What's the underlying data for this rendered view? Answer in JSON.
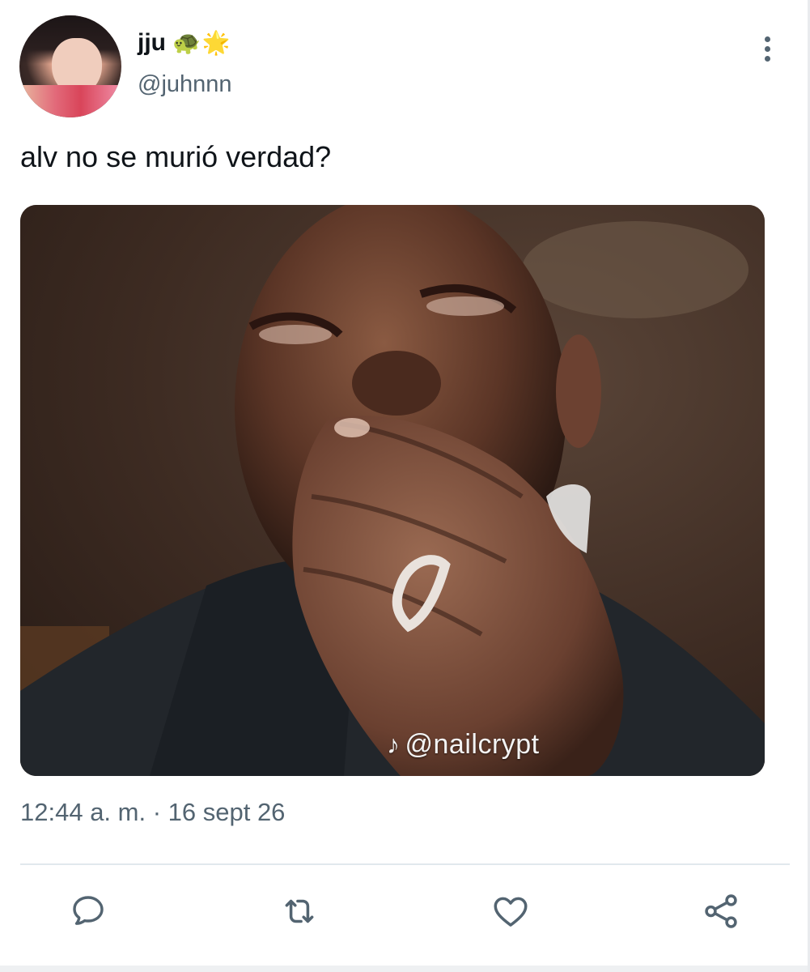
{
  "tweet": {
    "author": {
      "display_name": "jju",
      "emojis": [
        "🐢",
        "🌟"
      ],
      "handle": "@juhnnn"
    },
    "text": "alv no se murió verdad?",
    "media": {
      "watermark_icon": "tiktok-icon",
      "watermark_text": "@nailcrypt"
    },
    "timestamp": "12:44 a. m. · 16 sept 26",
    "actions": [
      {
        "name": "reply",
        "icon": "comment-icon"
      },
      {
        "name": "retweet",
        "icon": "retweet-icon"
      },
      {
        "name": "like",
        "icon": "heart-icon"
      },
      {
        "name": "share",
        "icon": "share-icon"
      }
    ]
  },
  "colors": {
    "text_primary": "#0f1419",
    "text_secondary": "#536471",
    "divider": "#e1e8ed"
  }
}
